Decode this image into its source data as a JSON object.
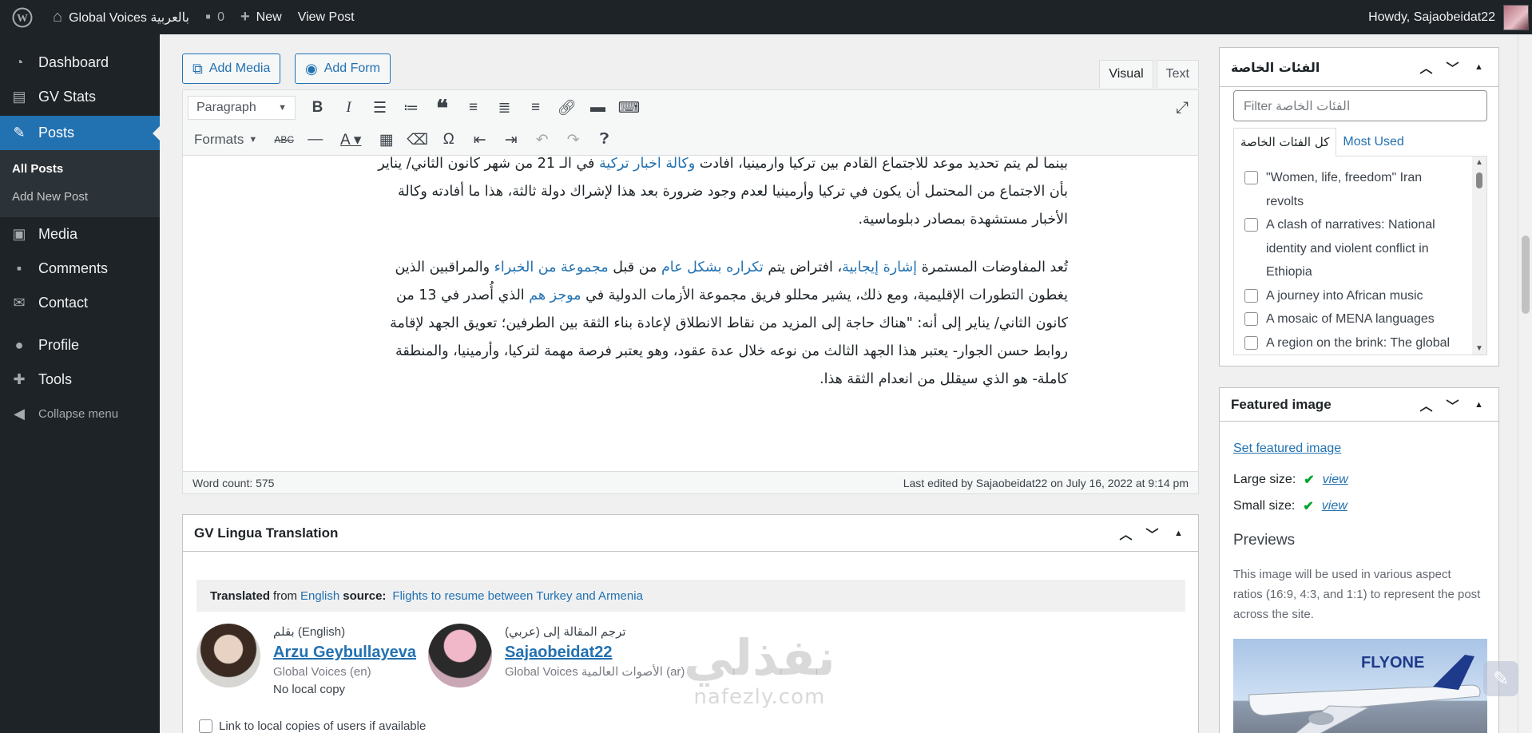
{
  "admin_bar": {
    "site_name": "Global Voices بالعربية",
    "comments_count": "0",
    "new_label": "New",
    "view_post_label": "View Post",
    "howdy": "Howdy, Sajaobeidat22"
  },
  "menu": {
    "dashboard": "Dashboard",
    "gv_stats": "GV Stats",
    "posts": "Posts",
    "all_posts": "All Posts",
    "add_new_post": "Add New Post",
    "media": "Media",
    "comments": "Comments",
    "contact": "Contact",
    "profile": "Profile",
    "tools": "Tools",
    "collapse": "Collapse menu"
  },
  "editor": {
    "add_media": "Add Media",
    "add_form": "Add Form",
    "tab_visual": "Visual",
    "tab_text": "Text",
    "format_select": "Paragraph",
    "formats_label": "Formats",
    "paragraphs": [
      {
        "lines": [
          {
            "parts": [
              {
                "t": "بينما لم يتم تحديد موعد للاجتماع القادم بين تركيا وأرمينيا، أفادت "
              },
              {
                "t": "وكالة أخبار تركية",
                "link": true
              },
              {
                "t": " في الـ 21 من شهر كانون الثاني/ يناير"
              }
            ]
          },
          {
            "parts": [
              {
                "t": "بأن الاجتماع من المحتمل أن يكون في تركيا وأرمينيا لعدم وجود ضرورة بعد هذا لإشراك دولة ثالثة، هذا ما أفادته وكالة"
              }
            ]
          },
          {
            "parts": [
              {
                "t": "الأخبار مستشهدة بمصادر دبلوماسية."
              }
            ]
          }
        ]
      },
      {
        "lines": [
          {
            "parts": [
              {
                "t": "تُعد المفاوضات المستمرة "
              },
              {
                "t": "إشارة إيجابية",
                "link": true
              },
              {
                "t": "، افتراض يتم "
              },
              {
                "t": "تكراره بشكل عام",
                "link": true
              },
              {
                "t": " من قبل "
              },
              {
                "t": "مجموعة من الخبراء",
                "link": true
              },
              {
                "t": " والمراقبين الذين"
              }
            ]
          },
          {
            "parts": [
              {
                "t": "يغطون التطورات الإقليمية، ومع ذلك، يشير محللو فريق مجموعة الأزمات الدولية في "
              },
              {
                "t": "موجز هم",
                "link": true
              },
              {
                "t": " الذي أُصدر في 13 من"
              }
            ]
          },
          {
            "parts": [
              {
                "t": "كانون الثاني/ يناير إلى أنه: \"هناك حاجة إلى المزيد من نقاط الانطلاق لإعادة بناء الثقة بين الطرفين؛ تعويق الجهد لإقامة"
              }
            ]
          },
          {
            "parts": [
              {
                "t": "روابط حسن الجوار- يعتبر هذا الجهد الثالث من نوعه خلال عدة عقود، وهو يعتبر فرصة مهمة لتركيا، وأرمينيا، والمنطقة"
              }
            ]
          },
          {
            "parts": [
              {
                "t": "كاملة- هو الذي سيقلل من انعدام الثقة هذا."
              }
            ]
          }
        ]
      }
    ],
    "word_count": "Word count: 575",
    "last_edited": "Last edited by Sajaobeidat22 on July 16, 2022 at 9:14 pm"
  },
  "lingua": {
    "title": "GV Lingua Translation",
    "translated_label": "Translated",
    "from_text": "from",
    "from_lang": "English",
    "source_label": "source:",
    "source_title": "Flights to resume between Turkey and Armenia",
    "author": {
      "role": "بقلم (English)",
      "name": "Arzu Geybullayeva",
      "site": "Global Voices (en)",
      "copy": "No local copy"
    },
    "translator": {
      "role": "ترجم المقالة إلى (عربي)",
      "name": "Sajaobeidat22",
      "site": "Global Voices الأصوات العالمية (ar)"
    },
    "link_local": "Link to local copies of users if available"
  },
  "categories": {
    "title": "الفئات الخاصة",
    "filter_placeholder": "Filter الفئات الخاصة",
    "tab_all": "كل الفئات الخاصة",
    "tab_most_used": "Most Used",
    "items": [
      "\"Women, life, freedom\" Iran revolts",
      "A clash of narratives: National identity and violent conflict in Ethiopia",
      "A journey into African music",
      "A mosaic of MENA languages",
      "A region on the brink: The global"
    ]
  },
  "featured": {
    "title": "Featured image",
    "set_link": "Set featured image",
    "large_label": "Large size:",
    "small_label": "Small size:",
    "view_label": "view",
    "previews_title": "Previews",
    "description": "This image will be used in various aspect ratios (16:9, 4:3, and 1:1) to represent the post across the site.",
    "plane_text": "FLYONE"
  },
  "watermark": {
    "big": "نفذلي",
    "small": "nafezly.com"
  },
  "colors": {
    "admin_bg": "#1d2327",
    "accent": "#2271b1",
    "page_bg": "#f0f0f1",
    "success": "#00a32a"
  }
}
